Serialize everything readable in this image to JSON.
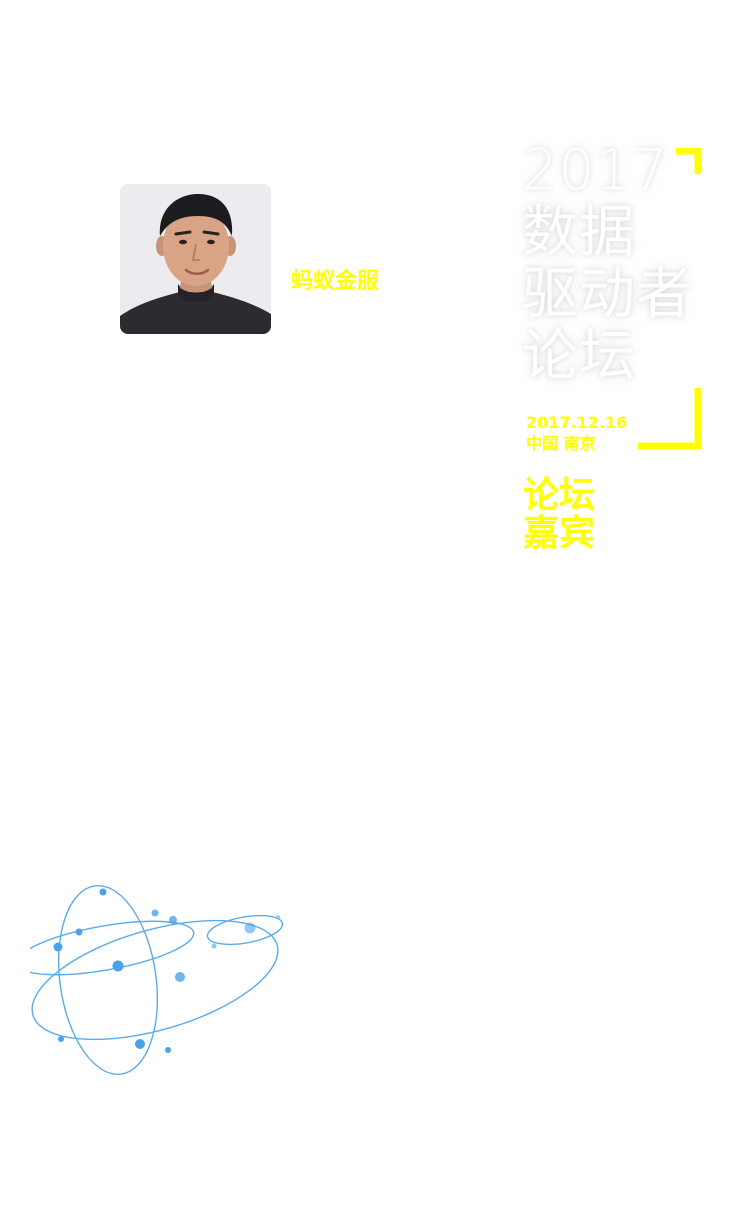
{
  "speaker": {
    "company": "蚂蚁金服"
  },
  "forum": {
    "title_lines": [
      "2017",
      "数据",
      "驱动者",
      "论坛"
    ],
    "date": "2017.12.16",
    "location": "中国 南京",
    "section_lines": [
      "论坛",
      "嘉宾"
    ]
  },
  "colors": {
    "accent": "#ffff00",
    "title": "#ffffff",
    "graphic": "#4aa3ea"
  },
  "icons": {
    "orbit": "orbit-icon"
  }
}
